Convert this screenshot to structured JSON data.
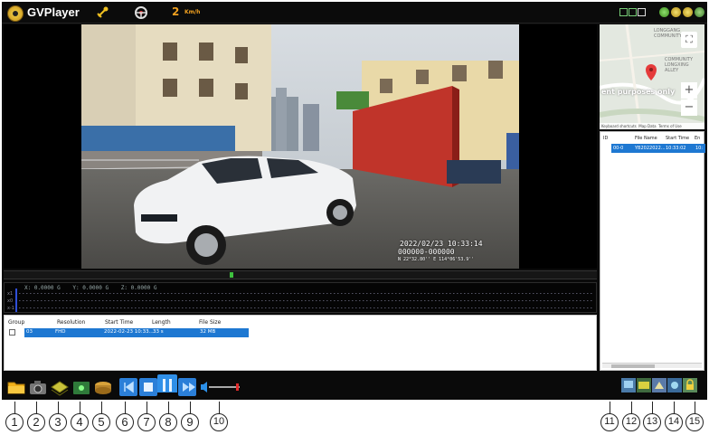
{
  "app": {
    "title": "GVPlayer",
    "speed_value": "2",
    "speed_unit": "Km/h"
  },
  "osd": {
    "datetime": "2022/02/23 10:33:14",
    "id_line": "000000-000000",
    "coords": "N 22°32.80'' E 114°06'53.9''"
  },
  "gsensor": {
    "x": "X: 0.0000 G",
    "y": "Y: 0.0000 G",
    "z": "Z: 0.0000 G",
    "axis": [
      "x1",
      "x0",
      "x-1"
    ]
  },
  "file_table": {
    "headers": [
      "Group",
      "Resolution",
      "Start Time",
      "Length",
      "File Size"
    ],
    "rows": [
      {
        "group": "03",
        "resolution": "FHD",
        "start_time": "2022-02-23 10:33...",
        "length": "33 s",
        "file_size": "32 MB"
      }
    ]
  },
  "map": {
    "purposes": "ent purposes only",
    "shortcuts": "Keyboard shortcuts",
    "map_data": "Map Data",
    "terms": "Terms of Use",
    "zoom_in": "+",
    "zoom_out": "−",
    "fullscreen": "⛶",
    "area_labels": [
      "LONGGANG",
      "COMMUNITY",
      "LONGXING",
      "ALLEY",
      "COMMUNITY"
    ]
  },
  "file_list": {
    "headers": [
      "ID",
      "File Name",
      "Start Time",
      "En"
    ],
    "rows": [
      {
        "id": "00-0",
        "name": "YB2022022...",
        "start": "10:33:02",
        "end": "10:"
      }
    ]
  },
  "callouts": [
    "1",
    "2",
    "3",
    "4",
    "5",
    "6",
    "7",
    "8",
    "9",
    "10",
    "11",
    "12",
    "13",
    "14",
    "15"
  ]
}
